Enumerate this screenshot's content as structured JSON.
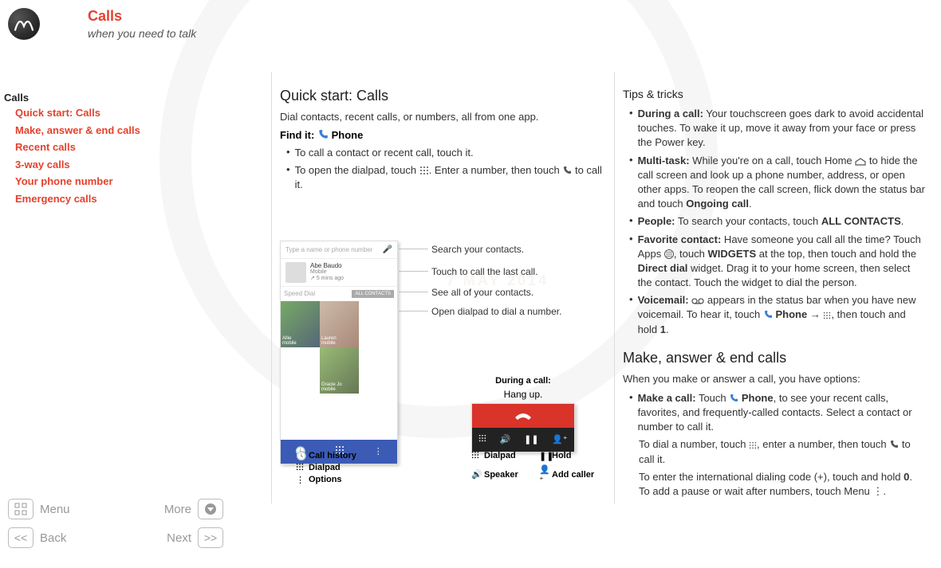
{
  "header": {
    "title": "Calls",
    "subtitle": "when you need to talk"
  },
  "watermark_date": "7 MAY 2014",
  "nav": {
    "root": "Calls",
    "items": [
      "Quick start: Calls",
      "Make, answer & end calls",
      "Recent calls",
      "3-way calls",
      "Your phone number",
      "Emergency calls"
    ]
  },
  "bottom_nav": {
    "menu": "Menu",
    "more": "More",
    "back": "Back",
    "next": "Next"
  },
  "quick_start": {
    "heading": "Quick start: Calls",
    "intro": "Dial contacts, recent calls, or numbers, all from one app.",
    "find_it_label": "Find it:",
    "find_it_value": "Phone",
    "bullets": [
      {
        "text": "To call a contact or recent call, touch it."
      },
      {
        "prefix": "To open the dialpad, touch ",
        "suffix": ". Enter a number, then touch ",
        "tail": " to call it."
      }
    ]
  },
  "phone_mock": {
    "search_placeholder": "Type a name or phone number",
    "recent": {
      "name": "Abe Baudo",
      "line2": "Mobile",
      "line3": "5 mins ago"
    },
    "speed_dial": "Speed Dial",
    "all_contacts": "ALL CONTACTS",
    "tiles": [
      {
        "name": "Allie",
        "sub": "mobile"
      },
      {
        "name": "Lauren",
        "sub": "mobile"
      },
      {
        "name": "Gracie Jo",
        "sub": "mobile"
      }
    ]
  },
  "callouts": {
    "search": "Search your contacts.",
    "last_call": "Touch to call the last call.",
    "all_contacts": "See all of your contacts.",
    "dialpad": "Open dialpad to dial a number."
  },
  "bottom_labels": {
    "history": "Call history",
    "dialpad": "Dialpad",
    "options": "Options"
  },
  "in_call": {
    "title": "During a call:",
    "hangup": "Hang up.",
    "dialpad": "Dialpad",
    "hold": "Hold",
    "speaker": "Speaker",
    "add": "Add caller"
  },
  "tips": {
    "heading": "Tips & tricks",
    "items": [
      {
        "bold": "During a call:",
        "text": " Your touchscreen goes dark to avoid accidental touches. To wake it up, move it away from your face or press the Power key."
      },
      {
        "bold": "Multi-task:",
        "text_a": " While you're on a call, touch Home ",
        "text_b": " to hide the call screen and look up a phone number, address, or open other apps. To reopen the call screen, flick down the status bar and touch ",
        "bold2": "Ongoing call",
        "tail": "."
      },
      {
        "bold": "People:",
        "text": " To search your contacts, touch ",
        "bold2": "ALL CONTACTS",
        "tail": "."
      },
      {
        "bold": "Favorite contact:",
        "text_a": " Have someone you call all the time? Touch Apps ",
        "text_b": ", touch ",
        "bold2": "WIDGETS",
        "text_c": " at the top, then touch and hold the ",
        "bold3": "Direct dial",
        "text_d": "  widget. Drag it to your home screen, then select the contact. Touch the widget to dial the person."
      },
      {
        "bold": "Voicemail:",
        "text_a": " ",
        "text_b": " appears in the status bar when you have new voicemail. To hear it, touch ",
        "bold2": "Phone",
        "text_c": " → ",
        "text_d": ", then touch and hold ",
        "bold3": "1",
        "tail": "."
      }
    ]
  },
  "make": {
    "heading": "Make, answer & end calls",
    "intro": "When you make or answer a call, you have options:",
    "b1_bold": "Make a call:",
    "b1_a": " Touch ",
    "b1_phone": "Phone",
    "b1_b": ", to see your recent calls, favorites, and frequently-called contacts. Select a contact or number to call it.",
    "p2_a": "To dial a number, touch ",
    "p2_b": ", enter a number, then touch ",
    "p2_c": " to call it.",
    "p3_a": "To enter the international dialing code (+), touch and hold ",
    "p3_bold": "0",
    "p3_b": ". To add a pause or wait after numbers, touch Menu ",
    "p3_c": "."
  }
}
